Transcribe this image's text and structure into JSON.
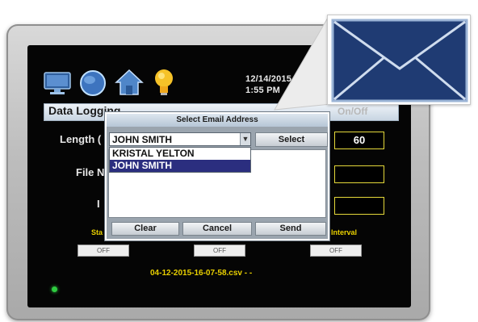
{
  "status_bar": {
    "date": "12/14/2015",
    "time": "1:55 PM"
  },
  "header": {
    "title": "Data Logging",
    "onoff": "On/Off"
  },
  "form": {
    "length_label": "Length (",
    "length_value": "60",
    "file_label": "File N",
    "third_label": "I",
    "start_label": "Sta",
    "interval_label": "Interval",
    "toggle_labels": [
      "OFF",
      "OFF",
      "OFF"
    ],
    "filename": "04-12-2015-16-07-58.csv - -"
  },
  "dialog": {
    "title": "Select Email Address",
    "selected_value": "JOHN SMITH",
    "options": [
      "KRISTAL YELTON",
      "JOHN SMITH"
    ],
    "highlighted_index": 1,
    "select_label": "Select",
    "clear_label": "Clear",
    "cancel_label": "Cancel",
    "send_label": "Send"
  },
  "icons": [
    "monitor-icon",
    "globe-icon",
    "home-icon",
    "lightbulb-icon",
    "envelope-icon"
  ],
  "colors": {
    "accent_yellow": "#e9d000",
    "highlight": "#2b2e7f",
    "envelope": "#1f3b73",
    "status_led": "#2ecc40"
  }
}
